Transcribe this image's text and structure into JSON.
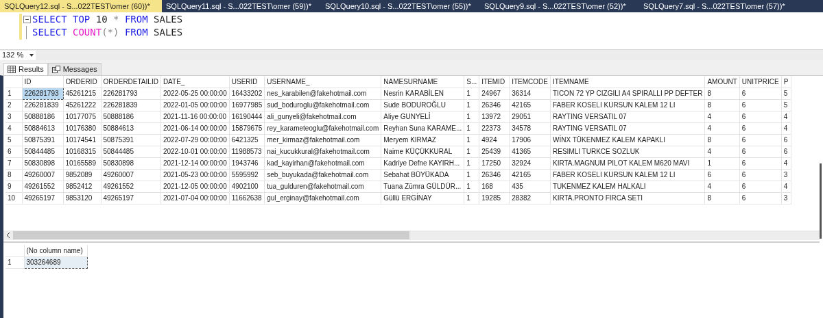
{
  "tabs": [
    {
      "label": "SQLQuery12.sql - S...022TEST\\omer (60))*",
      "selected": true
    },
    {
      "label": "SQLQuery11.sql - S...022TEST\\omer (59))*",
      "selected": false
    },
    {
      "label": "SQLQuery10.sql - S...022TEST\\omer (55))*",
      "selected": false
    },
    {
      "label": "SQLQuery9.sql - S...022TEST\\omer (52))*",
      "selected": false
    },
    {
      "label": "SQLQuery7.sql - S...022TEST\\omer (57))*",
      "selected": false
    }
  ],
  "editor": {
    "lines": [
      [
        {
          "kind": "keyword",
          "text": "SELECT"
        },
        {
          "kind": "keyword",
          "text": "TOP"
        },
        {
          "kind": "plain",
          "text": "10"
        },
        {
          "kind": "operator",
          "text": "*"
        },
        {
          "kind": "keyword",
          "text": "FROM"
        },
        {
          "kind": "plain",
          "text": "SALES"
        }
      ],
      [
        {
          "kind": "keyword",
          "text": "SELECT"
        },
        {
          "kind": "function",
          "text": "COUNT"
        },
        {
          "kind": "operator",
          "text": "(*)"
        },
        {
          "kind": "keyword",
          "text": "FROM"
        },
        {
          "kind": "plain",
          "text": "SALES"
        }
      ]
    ]
  },
  "zoom": {
    "value": "132 %"
  },
  "result_tabs": [
    {
      "label": "Results",
      "selected": true
    },
    {
      "label": "Messages",
      "selected": false
    }
  ],
  "grid1": {
    "columns": [
      "ID",
      "ORDERID",
      "ORDERDETAILID",
      "DATE_",
      "USERID",
      "USERNAME_",
      "NAMESURNAME",
      "S...",
      "ITEMID",
      "ITEMCODE",
      "ITEMNAME",
      "AMOUNT",
      "UNITPRICE",
      "P"
    ],
    "rows": [
      {
        "num": "1",
        "selected": true,
        "cells": [
          "226281793",
          "45261215",
          "226281793",
          "2022-05-25 00:00:00",
          "16433202",
          "nes_karabilen@fakehotmail.com",
          "Nesrin KARABİLEN",
          "1",
          "24967",
          "36314",
          "TICON 72 YP CIZGILI A4 SPIRALLI PP DEFTER",
          "8",
          "6",
          "5"
        ]
      },
      {
        "num": "2",
        "selected": false,
        "cells": [
          "226281839",
          "45261222",
          "226281839",
          "2022-01-05 00:00:00",
          "16977985",
          "sud_boduroglu@fakehotmail.com",
          "Sude BODUROĞLU",
          "1",
          "26346",
          "42165",
          "FABER KOSELI KURSUN KALEM 12 LI",
          "8",
          "6",
          "5"
        ]
      },
      {
        "num": "3",
        "selected": false,
        "cells": [
          "50888186",
          "10177075",
          "50888186",
          "2021-11-16 00:00:00",
          "16190444",
          "ali_gunyeli@fakehotmail.com",
          "Aliye GUNYELİ",
          "1",
          "13972",
          "29051",
          "RAYTING VERSATIL 07",
          "4",
          "6",
          "4"
        ]
      },
      {
        "num": "4",
        "selected": false,
        "cells": [
          "50884613",
          "10176380",
          "50884613",
          "2021-06-14 00:00:00",
          "15879675",
          "rey_karameteoglu@fakehotmail.com",
          "Reyhan Suna KARAME...",
          "1",
          "22373",
          "34578",
          "RAYTING VERSATIL 07",
          "4",
          "6",
          "4"
        ]
      },
      {
        "num": "5",
        "selected": false,
        "cells": [
          "50875391",
          "10174541",
          "50875391",
          "2022-07-29 00:00:00",
          "6421325",
          "mer_kirmaz@fakehotmail.com",
          "Meryem KIRMAZ",
          "1",
          "4924",
          "17906",
          "WİNX TÜKENMEZ KALEM KAPAKLI",
          "8",
          "6",
          "6"
        ]
      },
      {
        "num": "6",
        "selected": false,
        "cells": [
          "50844485",
          "10168315",
          "50844485",
          "2022-10-01 00:00:00",
          "11988573",
          "nai_kucukkural@fakehotmail.com",
          "Naime KÜÇÜKKURAL",
          "1",
          "25439",
          "41365",
          "RESIMLI TURKCE SOZLUK",
          "4",
          "6",
          "6"
        ]
      },
      {
        "num": "7",
        "selected": false,
        "cells": [
          "50830898",
          "10165589",
          "50830898",
          "2021-12-14 00:00:00",
          "1943746",
          "kad_kayirhan@fakehotmail.com",
          "Kadriye Defne KAYIRH...",
          "1",
          "17250",
          "32924",
          "KIRTA.MAGNUM PILOT KALEM M620 MAVI",
          "1",
          "6",
          "4"
        ]
      },
      {
        "num": "8",
        "selected": false,
        "cells": [
          "49260007",
          "9852089",
          "49260007",
          "2021-05-23 00:00:00",
          "5595992",
          "seb_buyukada@fakehotmail.com",
          "Sebahat BÜYÜKADA",
          "1",
          "26346",
          "42165",
          "FABER KOSELI KURSUN KALEM 12 LI",
          "6",
          "6",
          "3"
        ]
      },
      {
        "num": "9",
        "selected": false,
        "cells": [
          "49261552",
          "9852412",
          "49261552",
          "2021-12-05 00:00:00",
          "4902100",
          "tua_gulduren@fakehotmail.com",
          "Tuana Zümra GÜLDÜR...",
          "1",
          "168",
          "435",
          "TUKENMEZ KALEM HALKALI",
          "4",
          "6",
          "4"
        ]
      },
      {
        "num": "10",
        "selected": false,
        "cells": [
          "49265197",
          "9853120",
          "49265197",
          "2021-07-04 00:00:00",
          "11662638",
          "gul_erginay@fakehotmail.com",
          "Güllü ERGİNAY",
          "1",
          "19285",
          "28382",
          "KIRTA.PRONTO FIRCA SETI",
          "8",
          "6",
          "3"
        ]
      }
    ]
  },
  "grid2": {
    "columns": [
      "(No column name)"
    ],
    "rows": [
      {
        "num": "1",
        "selected": true,
        "cells": [
          "303264689"
        ]
      }
    ]
  }
}
